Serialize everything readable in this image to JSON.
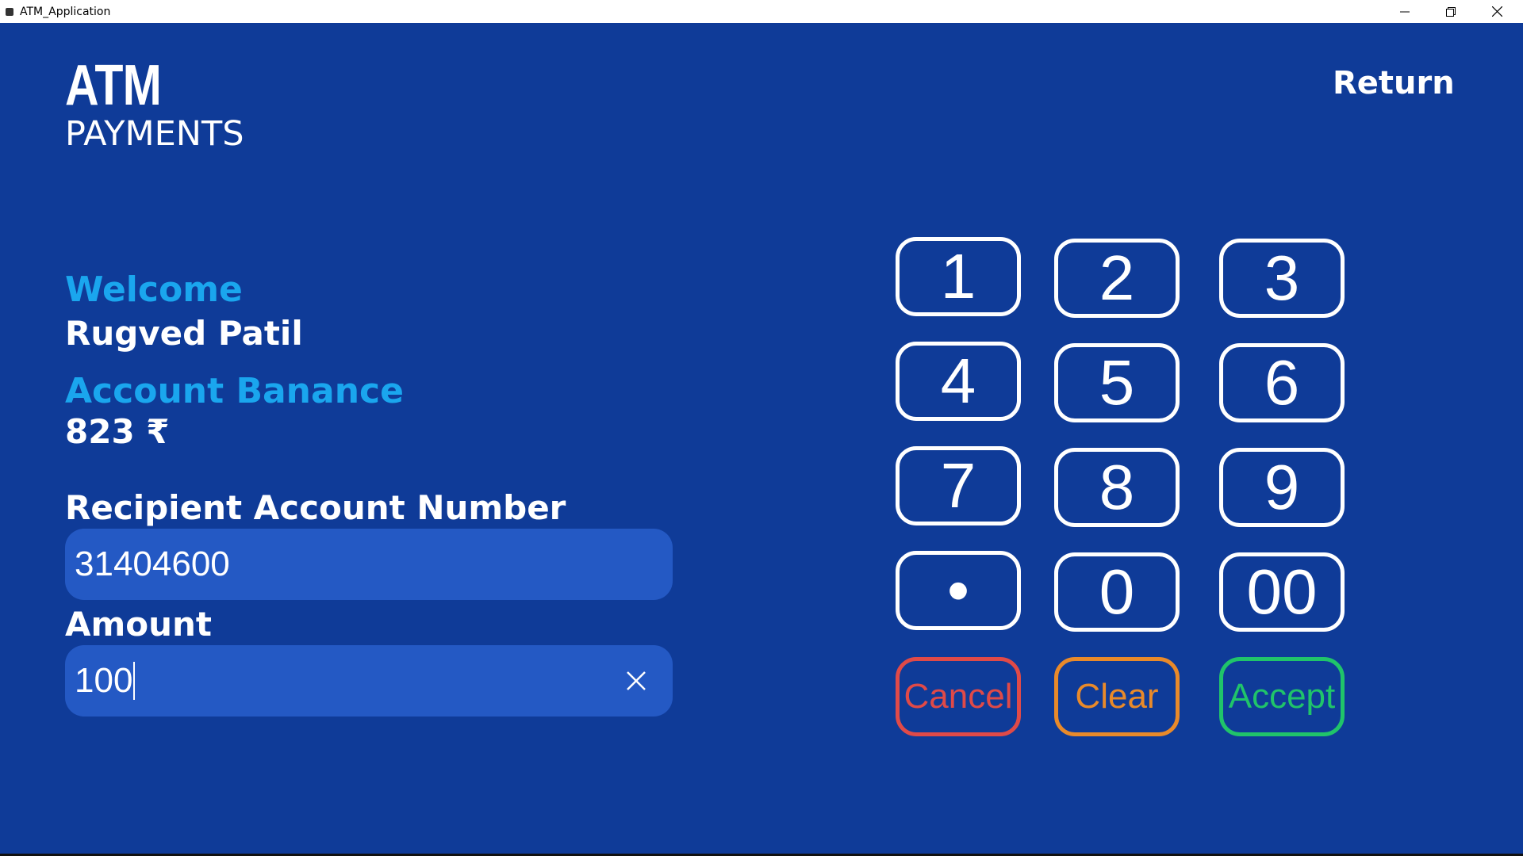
{
  "window": {
    "title": "ATM_Application"
  },
  "header": {
    "brand_top": "ATM",
    "brand_bottom": "PAYMENTS",
    "return_label": "Return"
  },
  "user": {
    "welcome_label": "Welcome",
    "name": "Rugved Patil",
    "balance_label": "Account Banance",
    "balance_value": "823 ₹"
  },
  "form": {
    "recipient_label": "Recipient Account Number",
    "recipient_value": "31404600",
    "amount_label": "Amount",
    "amount_value": "100"
  },
  "keypad": {
    "keys": [
      "1",
      "2",
      "3",
      "4",
      "5",
      "6",
      "7",
      "8",
      "9",
      "•",
      "0",
      "00"
    ],
    "cancel_label": "Cancel",
    "clear_label": "Clear",
    "accept_label": "Accept"
  },
  "colors": {
    "background": "#0f3b98",
    "field_bg": "#2459c4",
    "label_accent": "#1aa6ee",
    "cancel": "#e04a48",
    "clear": "#e98a2a",
    "accept": "#20c46a"
  },
  "icons": {
    "minimize": "minimize-icon",
    "restore": "restore-icon",
    "close": "close-icon",
    "clear_field": "close-x-icon"
  }
}
